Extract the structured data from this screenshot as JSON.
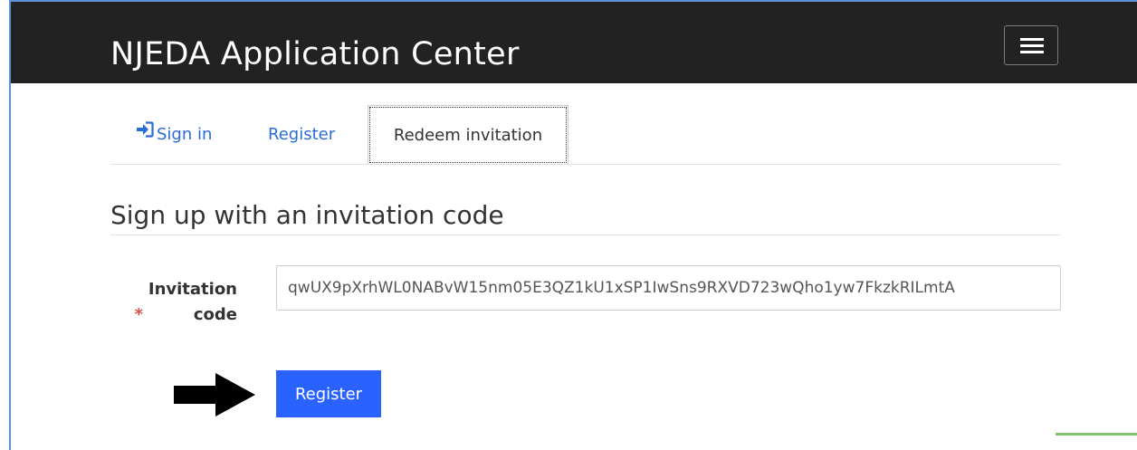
{
  "header": {
    "title": "NJEDA Application Center",
    "menu_icon": "hamburger-menu-icon"
  },
  "tabs": [
    {
      "label": "Sign in",
      "icon": "sign-in-icon",
      "active": false
    },
    {
      "label": "Register",
      "active": false
    },
    {
      "label": "Redeem invitation",
      "active": true
    }
  ],
  "form": {
    "heading": "Sign up with an invitation code",
    "required_marker": "*",
    "invitation_label": "Invitation code",
    "invitation_value": "qwUX9pXrhWL0NABvW15nm05E3QZ1kU1xSP1IwSns9RXVD723wQho1yw7FkzkRILmtA",
    "submit_label": "Register"
  },
  "annotation": {
    "arrow_icon": "pointer-arrow-icon"
  },
  "colors": {
    "navbar_bg": "#222222",
    "link": "#2a6cd6",
    "primary_button": "#2962ff",
    "required": "#d9534f"
  }
}
